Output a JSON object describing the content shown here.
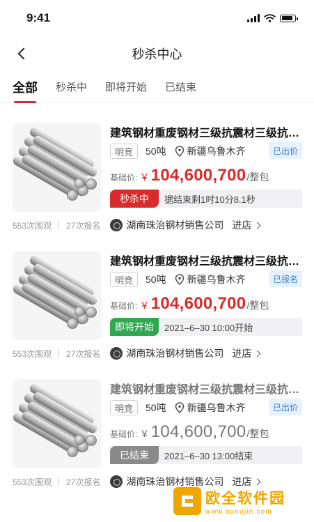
{
  "status_bar": {
    "time": "9:41"
  },
  "nav": {
    "title": "秒杀中心"
  },
  "tabs": [
    {
      "label": "全部",
      "active": true
    },
    {
      "label": "秒杀中",
      "active": false
    },
    {
      "label": "即将开始",
      "active": false
    },
    {
      "label": "已结束",
      "active": false
    }
  ],
  "cards": [
    {
      "title": "建筑钢材重废钢材三级抗震材三级抗震材",
      "mode": "明竞",
      "tonnage": "50吨",
      "location": "新疆乌鲁木齐",
      "badge": "已出价",
      "price_label": "基础价:",
      "currency": "¥",
      "price": "104,600,700",
      "unit": "/整包",
      "status_tag": "秒杀中",
      "status_text": "据结束剩1时10分8.1秒",
      "views": "553次围观",
      "signups": "27次报名",
      "company": "湖南珠治钢材销售公司",
      "enter": "进店"
    },
    {
      "title": "建筑钢材重废钢材三级抗震材三级抗震材",
      "mode": "明竞",
      "tonnage": "50吨",
      "location": "新疆乌鲁木齐",
      "badge": "已报名",
      "price_label": "基础价:",
      "currency": "¥",
      "price": "104,600,700",
      "unit": "/整包",
      "status_tag": "即将开始",
      "status_text": "2021–6–30  10:00开始",
      "views": "553次围观",
      "signups": "27次报名",
      "company": "湖南珠治钢材销售公司",
      "enter": "进店"
    },
    {
      "title": "建筑钢材重废钢材三级抗震材三级抗震材",
      "mode": "明竞",
      "tonnage": "50吨",
      "location": "新疆乌鲁木齐",
      "badge": "已出价",
      "price_label": "基础价:",
      "currency": "¥",
      "price": "104,600,700",
      "unit": "/整包",
      "status_tag": "已结束",
      "status_text": "2021–6–30  13:00结束",
      "views": "553次围观",
      "signups": "27次报名",
      "company": "湖南珠治钢材销售公司",
      "enter": "进店"
    }
  ],
  "watermark": {
    "title": "欧全软件园",
    "url": "www.apoujin.com"
  },
  "colors": {
    "accent": "#d92b2b",
    "upcoming": "#2fa84f",
    "ended": "#8a8a8a",
    "badge_bg": "#e7f1ff",
    "badge_text": "#3a7bd5",
    "watermark": "#f0a500"
  },
  "icons": {
    "back": "chevron-left-icon",
    "location": "location-pin-icon",
    "enter": "chevron-right-icon"
  }
}
